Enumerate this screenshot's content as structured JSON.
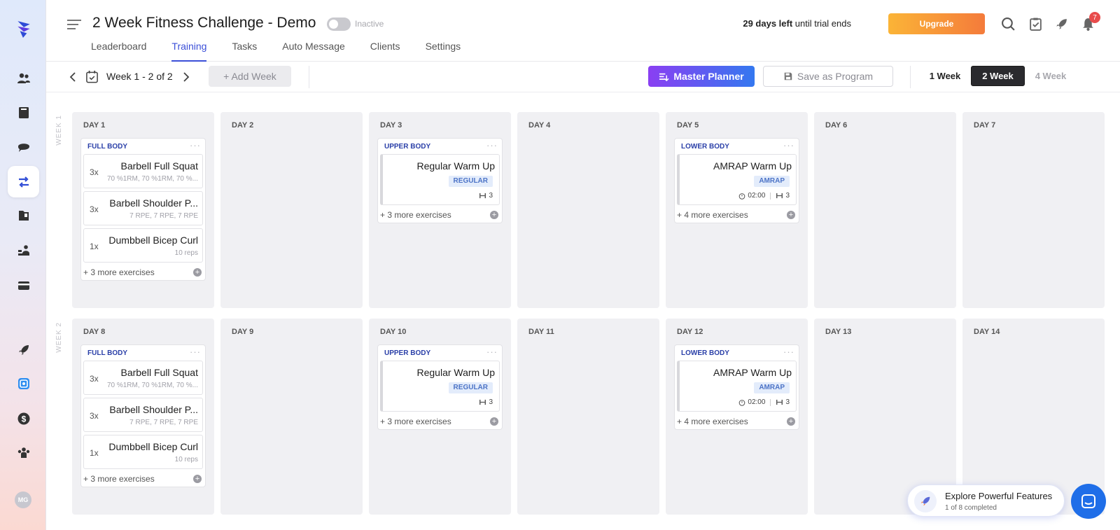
{
  "header": {
    "title": "2 Week Fitness Challenge - Demo",
    "status": "Inactive",
    "trial_bold": "29 days left",
    "trial_rest": " until trial ends",
    "upgrade_label": "Upgrade",
    "notification_count": "7"
  },
  "tabs": [
    "Leaderboard",
    "Training",
    "Tasks",
    "Auto Message",
    "Clients",
    "Settings"
  ],
  "active_tab": "Training",
  "toolbar": {
    "week_label": "Week 1 - 2 of 2",
    "add_week_label": "+ Add Week",
    "master_planner_label": "Master Planner",
    "save_program_label": "Save as Program",
    "week_options": [
      "1 Week",
      "2 Week",
      "4 Week"
    ],
    "selected_week_option": "2 Week"
  },
  "weeks": [
    {
      "label": "WEEK 1",
      "days": [
        "DAY 1",
        "DAY 2",
        "DAY 3",
        "DAY 4",
        "DAY 5",
        "DAY 6",
        "DAY 7"
      ]
    },
    {
      "label": "WEEK 2",
      "days": [
        "DAY 8",
        "DAY 9",
        "DAY 10",
        "DAY 11",
        "DAY 12",
        "DAY 13",
        "DAY 14"
      ]
    }
  ],
  "workouts": {
    "full_body": {
      "title": "FULL BODY",
      "exercises": [
        {
          "sets": "3x",
          "name": "Barbell Full Squat",
          "detail": "70 %1RM, 70 %1RM, 70 %..."
        },
        {
          "sets": "3x",
          "name": "Barbell Shoulder P...",
          "detail": "7 RPE, 7 RPE, 7 RPE"
        },
        {
          "sets": "1x",
          "name": "Dumbbell Bicep Curl",
          "detail": "10 reps"
        }
      ],
      "more": "+ 3 more exercises"
    },
    "upper_body": {
      "title": "UPPER BODY",
      "exercise_name": "Regular Warm Up",
      "tag": "REGULAR",
      "rounds": "3",
      "more": "+ 3 more exercises"
    },
    "lower_body": {
      "title": "LOWER BODY",
      "exercise_name": "AMRAP Warm Up",
      "tag": "AMRAP",
      "time": "02:00",
      "rounds": "3",
      "more": "+ 4 more exercises"
    }
  },
  "explore": {
    "title": "Explore Powerful Features",
    "subtitle": "1 of 8 completed"
  },
  "user": {
    "initials": "MG"
  },
  "colors": {
    "accent": "#3b4fd8",
    "upgrade_start": "#fbb437",
    "upgrade_end": "#f47b3b",
    "master_start": "#8a3ff2",
    "master_end": "#3478f0",
    "badge": "#e84c4c",
    "chat": "#1f6ee8"
  },
  "icons": {
    "sidebar": [
      "logo-icon",
      "clients-icon",
      "library-icon",
      "chat-icon",
      "training-icon",
      "folder-icon",
      "team-icon",
      "payment-card-icon",
      "rocket-icon",
      "app-icon",
      "dollar-icon",
      "community-icon"
    ],
    "header": [
      "search-icon",
      "task-check-icon",
      "rocket-icon",
      "bell-icon"
    ]
  }
}
